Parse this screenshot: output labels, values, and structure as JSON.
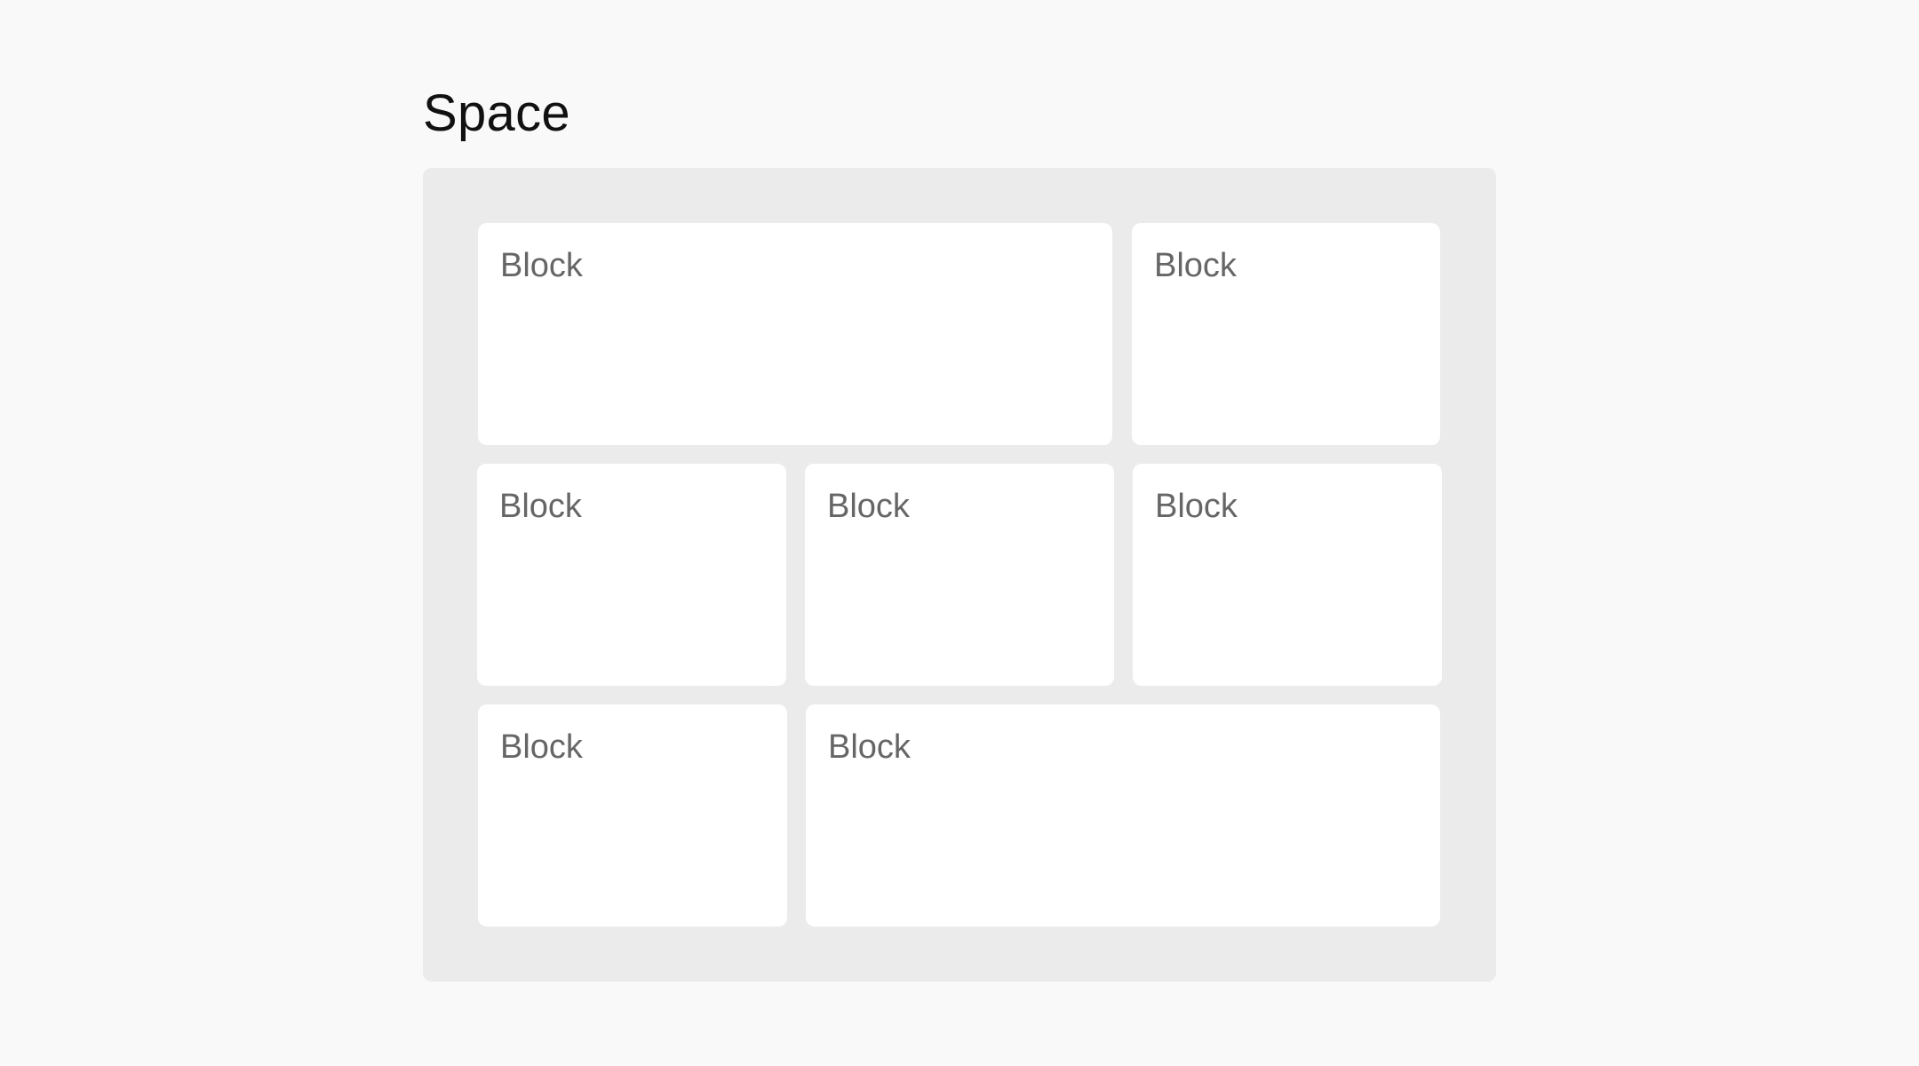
{
  "page": {
    "title": "Space"
  },
  "space": {
    "blocks": [
      {
        "label": "Block"
      },
      {
        "label": "Block"
      },
      {
        "label": "Block"
      },
      {
        "label": "Block"
      },
      {
        "label": "Block"
      },
      {
        "label": "Block"
      },
      {
        "label": "Block"
      }
    ]
  },
  "colors": {
    "page_background": "#f9f9f9",
    "panel_background": "#ebebeb",
    "block_background": "#ffffff",
    "title_text": "#111111",
    "block_text": "#666666"
  }
}
